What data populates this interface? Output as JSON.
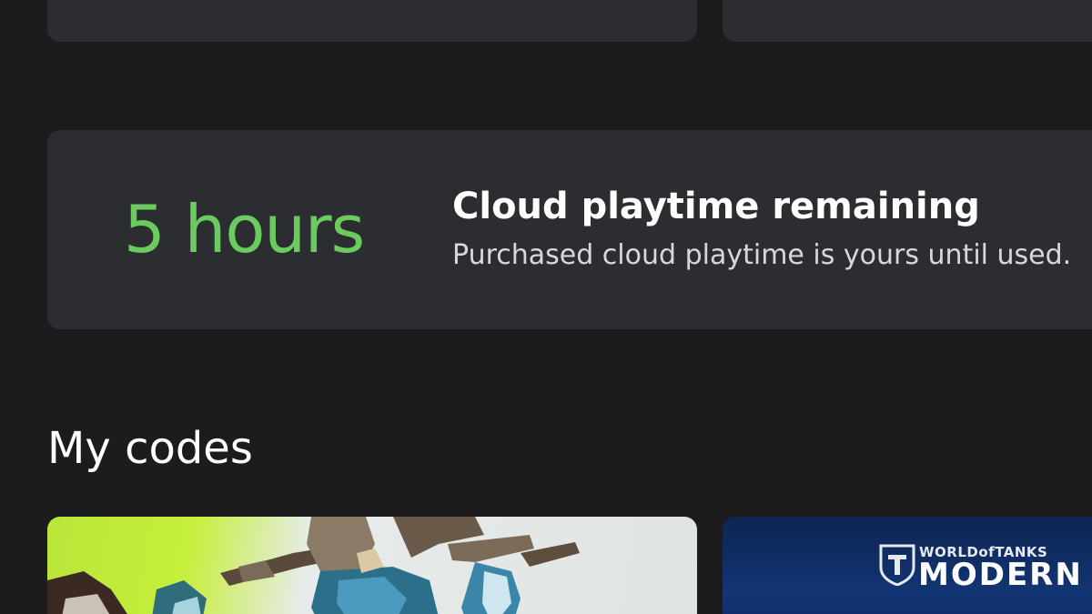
{
  "playtime": {
    "amount": "5 hours",
    "title": "Cloud playtime remaining",
    "subtitle": "Purchased cloud playtime is yours until used."
  },
  "codes": {
    "heading": "My codes",
    "tiles": [
      {
        "art": "game-character-art"
      },
      {
        "brand_small": "WORLDofTANKS",
        "brand_big": "MODERN A"
      }
    ]
  },
  "colors": {
    "background": "#1c1c1f",
    "card": "#2b2d31",
    "accent_green": "#6ccb5f"
  }
}
